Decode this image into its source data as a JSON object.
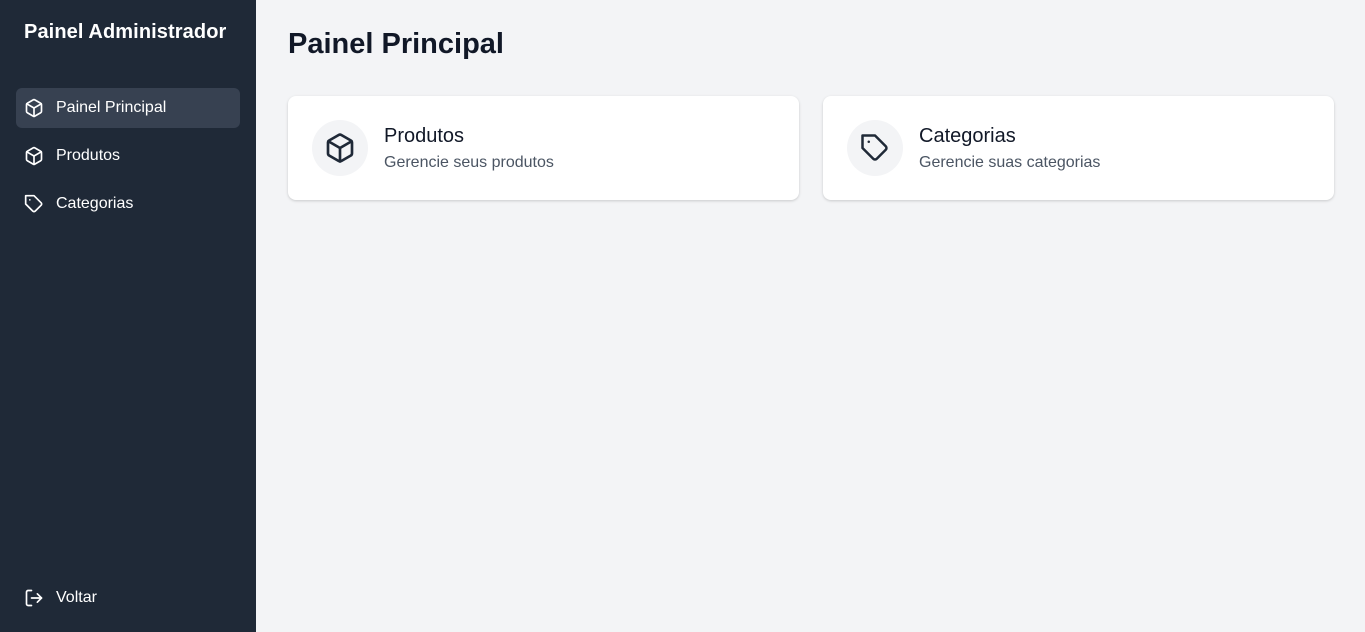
{
  "sidebar": {
    "brand": "Painel Administrador",
    "items": [
      {
        "label": "Painel Principal",
        "icon": "cube-icon",
        "active": true
      },
      {
        "label": "Produtos",
        "icon": "cube-icon",
        "active": false
      },
      {
        "label": "Categorias",
        "icon": "tag-icon",
        "active": false
      }
    ],
    "logout_label": "Voltar"
  },
  "main": {
    "title": "Painel Principal",
    "cards": [
      {
        "title": "Produtos",
        "subtitle": "Gerencie seus produtos",
        "icon": "cube-icon"
      },
      {
        "title": "Categorias",
        "subtitle": "Gerencie suas categorias",
        "icon": "tag-icon"
      }
    ]
  },
  "colors": {
    "sidebar_bg": "#1f2937",
    "active_item_bg": "#374151",
    "page_bg": "#f3f4f6",
    "card_bg": "#ffffff"
  }
}
